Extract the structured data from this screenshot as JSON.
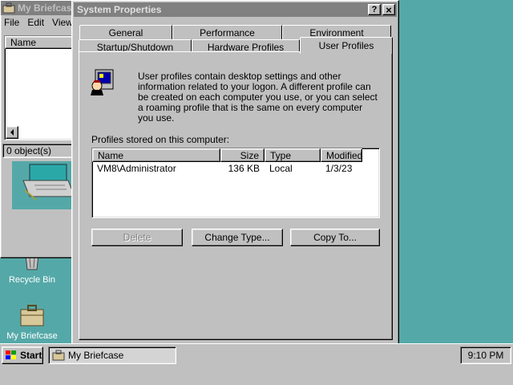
{
  "desktop": {
    "icons": [
      {
        "label": "Recycle Bin"
      },
      {
        "label": "My Briefcase"
      }
    ]
  },
  "briefcase_window": {
    "title": "My Briefcase",
    "menu": [
      "File",
      "Edit",
      "View"
    ],
    "column_name": "Name",
    "status": "0 object(s)"
  },
  "dialog": {
    "title": "System Properties",
    "help_button": "?",
    "close_button": "×",
    "tabs_back": [
      "General",
      "Performance",
      "Environment"
    ],
    "tabs_front": [
      "Startup/Shutdown",
      "Hardware Profiles",
      "User Profiles"
    ],
    "selected_tab": "User Profiles",
    "description": "User profiles contain desktop settings and other information related to your logon.  A different profile can be created on each computer you use, or you can select a roaming profile that is the same on every computer you use.",
    "list_label": "Profiles stored on this computer:",
    "columns": [
      "Name",
      "Size",
      "Type",
      "Modified"
    ],
    "rows": [
      {
        "name": "VM8\\Administrator",
        "size": "136 KB",
        "type": "Local",
        "modified": "1/3/23"
      }
    ],
    "buttons": {
      "delete": "Delete",
      "change_type": "Change Type...",
      "copy_to": "Copy To..."
    }
  },
  "taskbar": {
    "start": "Start",
    "task": "My Briefcase",
    "clock": "9:10 PM"
  },
  "colors": {
    "desktop": "#55a8a8",
    "face": "#c0c0c0",
    "inactive_title": "#808080"
  }
}
